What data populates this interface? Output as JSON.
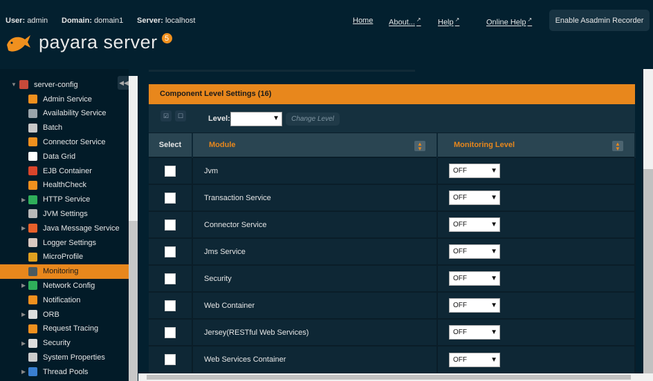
{
  "header": {
    "user_label": "User:",
    "user": "admin",
    "domain_label": "Domain:",
    "domain": "domain1",
    "server_label": "Server:",
    "server": "localhost",
    "links": [
      "Home",
      "About...",
      "Help",
      "Online Help"
    ],
    "recorder_button": "Enable Asadmin Recorder",
    "logo_text": "payara server",
    "version": "5"
  },
  "sidebar": {
    "root": "server-config",
    "items": [
      {
        "label": "Admin Service",
        "expandable": false,
        "color": "#f0901e"
      },
      {
        "label": "Availability Service",
        "expandable": false,
        "color": "#9aa4aa"
      },
      {
        "label": "Batch",
        "expandable": false,
        "color": "#c8c8c8"
      },
      {
        "label": "Connector Service",
        "expandable": false,
        "color": "#f0901e"
      },
      {
        "label": "Data Grid",
        "expandable": false,
        "color": "#ffffff"
      },
      {
        "label": "EJB Container",
        "expandable": false,
        "color": "#d9452b"
      },
      {
        "label": "HealthCheck",
        "expandable": false,
        "color": "#f0901e"
      },
      {
        "label": "HTTP Service",
        "expandable": true,
        "color": "#2fae5a"
      },
      {
        "label": "JVM Settings",
        "expandable": false,
        "color": "#b9b9b9"
      },
      {
        "label": "Java Message Service",
        "expandable": true,
        "color": "#e8602a"
      },
      {
        "label": "Logger Settings",
        "expandable": false,
        "color": "#d8c8c0"
      },
      {
        "label": "MicroProfile",
        "expandable": false,
        "color": "#e0a020"
      },
      {
        "label": "Monitoring",
        "expandable": false,
        "selected": true,
        "color": "#4a5a60"
      },
      {
        "label": "Network Config",
        "expandable": true,
        "color": "#2fae5a"
      },
      {
        "label": "Notification",
        "expandable": false,
        "color": "#f0901e"
      },
      {
        "label": "ORB",
        "expandable": true,
        "color": "#dddddd"
      },
      {
        "label": "Request Tracing",
        "expandable": false,
        "color": "#f0901e"
      },
      {
        "label": "Security",
        "expandable": true,
        "color": "#dddddd"
      },
      {
        "label": "System Properties",
        "expandable": false,
        "color": "#cccccc"
      },
      {
        "label": "Thread Pools",
        "expandable": true,
        "color": "#3a7fd0"
      }
    ]
  },
  "panel": {
    "title": "Component Level Settings (16)",
    "level_label": "Level:",
    "level_value": "",
    "change_level": "Change Level",
    "columns": [
      "Select",
      "Module",
      "Monitoring Level"
    ],
    "rows": [
      {
        "module": "Jvm",
        "level": "OFF"
      },
      {
        "module": "Transaction Service",
        "level": "OFF"
      },
      {
        "module": "Connector Service",
        "level": "OFF"
      },
      {
        "module": "Jms Service",
        "level": "OFF"
      },
      {
        "module": "Security",
        "level": "OFF"
      },
      {
        "module": "Web Container",
        "level": "OFF"
      },
      {
        "module": "Jersey(RESTful Web Services)",
        "level": "OFF"
      },
      {
        "module": "Web Services Container",
        "level": "OFF"
      }
    ]
  }
}
